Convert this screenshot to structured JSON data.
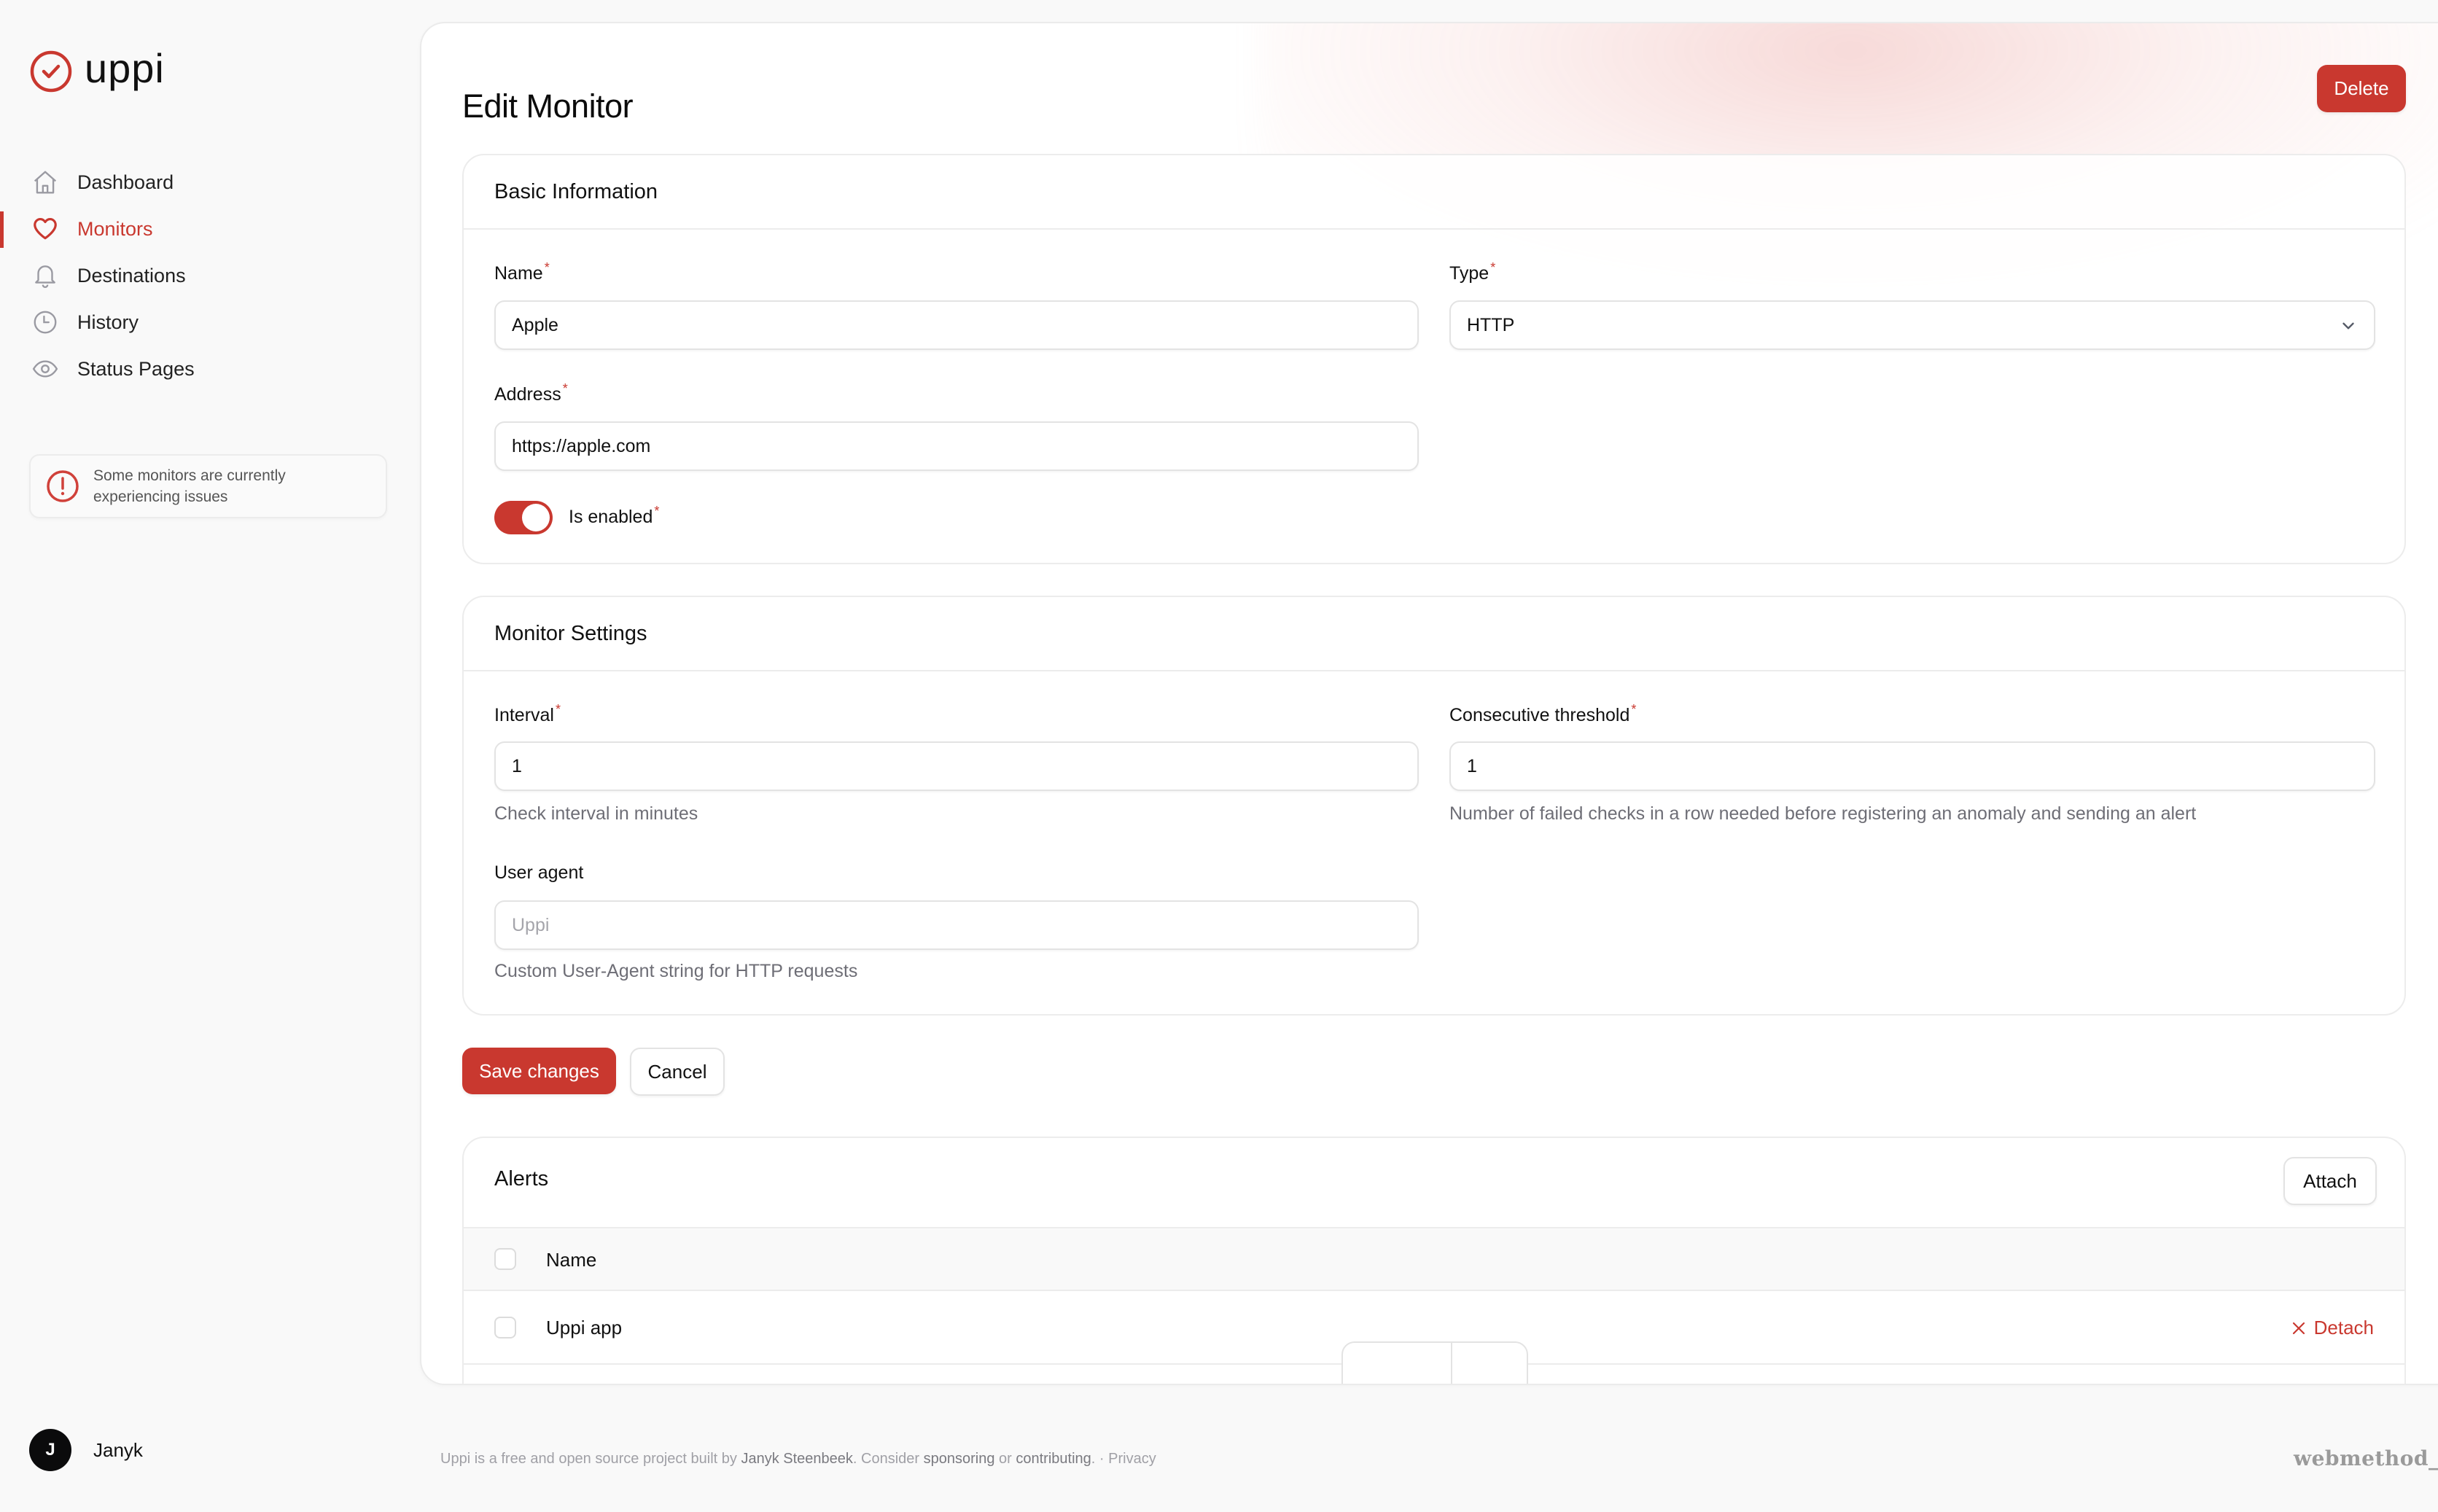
{
  "app": {
    "name": "uppi",
    "accent_color": "#c9382f"
  },
  "sidebar": {
    "items": [
      {
        "label": "Dashboard",
        "icon": "home-icon",
        "active": false
      },
      {
        "label": "Monitors",
        "icon": "heart-icon",
        "active": true
      },
      {
        "label": "Destinations",
        "icon": "bell-icon",
        "active": false
      },
      {
        "label": "History",
        "icon": "clock-icon",
        "active": false
      },
      {
        "label": "Status Pages",
        "icon": "eye-icon",
        "active": false
      }
    ],
    "issue_notice": {
      "icon": "exclamation-circle-icon",
      "line1": "Some monitors are currently",
      "line2": "experiencing issues"
    },
    "user": {
      "initial": "J",
      "name": "Janyk"
    }
  },
  "header": {
    "title": "Edit Monitor",
    "delete_label": "Delete"
  },
  "basic_info": {
    "title": "Basic Information",
    "name": {
      "label": "Name",
      "required": "*",
      "value": "Apple"
    },
    "type": {
      "label": "Type",
      "required": "*",
      "value": "HTTP"
    },
    "address": {
      "label": "Address",
      "required": "*",
      "value": "https://apple.com"
    },
    "enabled": {
      "label": "Is enabled",
      "required": "*",
      "value": true
    }
  },
  "monitor_settings": {
    "title": "Monitor Settings",
    "interval": {
      "label": "Interval",
      "required": "*",
      "value": "1",
      "help": "Check interval in minutes"
    },
    "threshold": {
      "label": "Consecutive threshold",
      "required": "*",
      "value": "1",
      "help": "Number of failed checks in a row needed before registering an anomaly and sending an alert"
    },
    "user_agent": {
      "label": "User agent",
      "value": "",
      "placeholder": "Uppi",
      "help": "Custom User-Agent string for HTTP requests"
    }
  },
  "actions": {
    "save_label": "Save changes",
    "cancel_label": "Cancel"
  },
  "alerts": {
    "title": "Alerts",
    "attach_label": "Attach",
    "columns": [
      "Name"
    ],
    "rows": [
      {
        "name": "Uppi app",
        "action": "Detach"
      }
    ]
  },
  "footer": {
    "part1": "Uppi is a free and open source project built by ",
    "author": "Janyk Steenbeek",
    "part2": ". Consider ",
    "sponsoring": "sponsoring",
    "part3": " or ",
    "contributing": "contributing",
    "part4": ". · ",
    "privacy": "Privacy",
    "brand": "webmethod_"
  }
}
